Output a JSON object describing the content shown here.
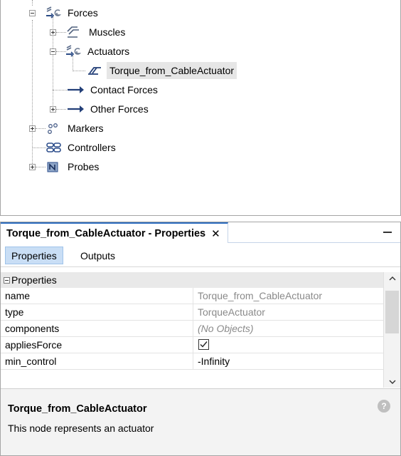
{
  "tree": {
    "nodes": [
      {
        "label": "Forces",
        "icon": "forces-icon"
      },
      {
        "label": "Muscles",
        "icon": "muscles-icon"
      },
      {
        "label": "Actuators",
        "icon": "actuators-icon"
      },
      {
        "label": "Torque_from_CableActuator",
        "icon": "actuator-item-icon",
        "selected": true
      },
      {
        "label": "Contact Forces",
        "icon": "arrow-icon"
      },
      {
        "label": "Other Forces",
        "icon": "arrow-icon"
      },
      {
        "label": "Markers",
        "icon": "markers-icon"
      },
      {
        "label": "Controllers",
        "icon": "controllers-icon"
      },
      {
        "label": "Probes",
        "icon": "probes-icon"
      }
    ]
  },
  "properties_panel": {
    "tab_title": "Torque_from_CableActuator - Properties",
    "close_glyph": "✕",
    "subtabs": [
      "Properties",
      "Outputs"
    ],
    "active_subtab": "Properties",
    "section_header": "Properties",
    "rows": [
      {
        "name": "name",
        "value": "Torque_from_CableActuator"
      },
      {
        "name": "type",
        "value": "TorqueActuator"
      },
      {
        "name": "components",
        "value": "(No Objects)"
      },
      {
        "name": "appliesForce",
        "checked": true
      },
      {
        "name": "min_control",
        "value": "-Infinity"
      }
    ],
    "description": {
      "title": "Torque_from_CableActuator",
      "text": "This node represents an actuator"
    },
    "help_glyph": "?"
  },
  "colors": {
    "accent": "#2c6cbf",
    "subtab_active": "#c9def5",
    "selection": "#e6e6e6"
  }
}
